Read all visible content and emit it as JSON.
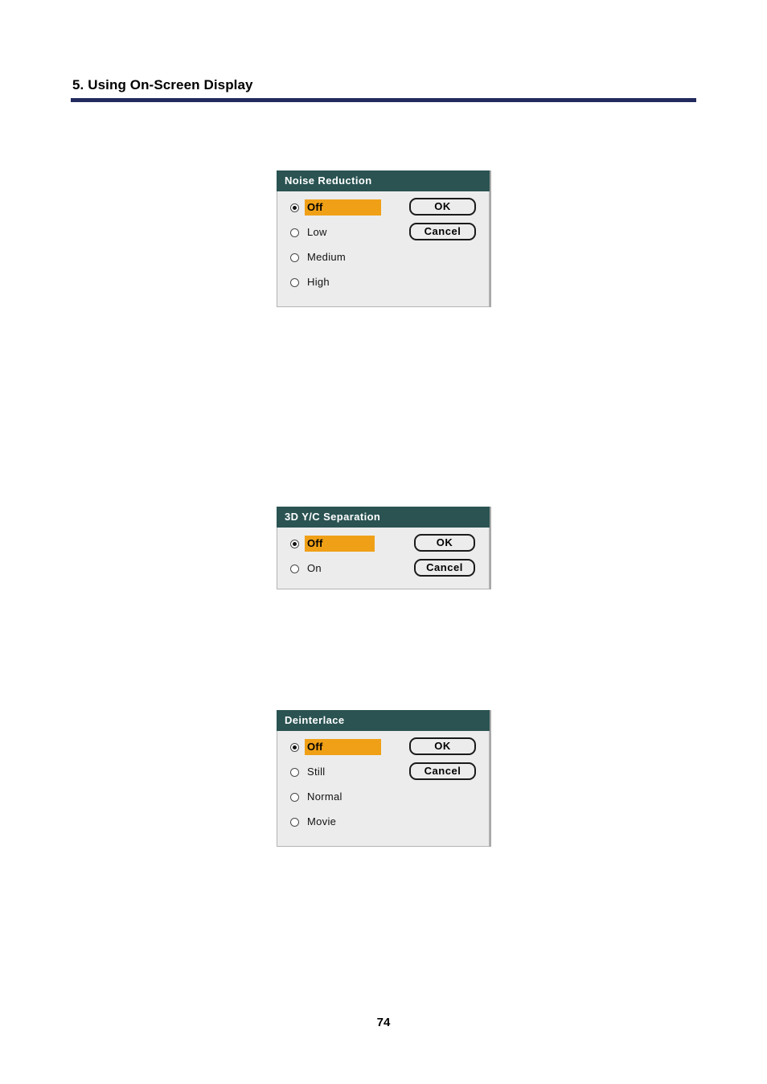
{
  "page": {
    "header_title": "5. Using On-Screen Display",
    "page_number": "74",
    "rule_color": "#232a5c"
  },
  "colors": {
    "titlebar": "#2a5352",
    "highlight": "#f0a017",
    "dialog_body": "#ececec"
  },
  "dialogs": [
    {
      "title": "Noise Reduction",
      "options": [
        {
          "label": "Off",
          "selected": true
        },
        {
          "label": "Low",
          "selected": false
        },
        {
          "label": "Medium",
          "selected": false
        },
        {
          "label": "High",
          "selected": false
        }
      ],
      "buttons": [
        {
          "label": "OK"
        },
        {
          "label": "Cancel"
        }
      ]
    },
    {
      "title": "3D Y/C Separation",
      "options": [
        {
          "label": "Off",
          "selected": true
        },
        {
          "label": "On",
          "selected": false
        }
      ],
      "buttons": [
        {
          "label": "OK"
        },
        {
          "label": "Cancel"
        }
      ]
    },
    {
      "title": "Deinterlace",
      "options": [
        {
          "label": "Off",
          "selected": true
        },
        {
          "label": "Still",
          "selected": false
        },
        {
          "label": "Normal",
          "selected": false
        },
        {
          "label": "Movie",
          "selected": false
        }
      ],
      "buttons": [
        {
          "label": "OK"
        },
        {
          "label": "Cancel"
        }
      ]
    }
  ]
}
